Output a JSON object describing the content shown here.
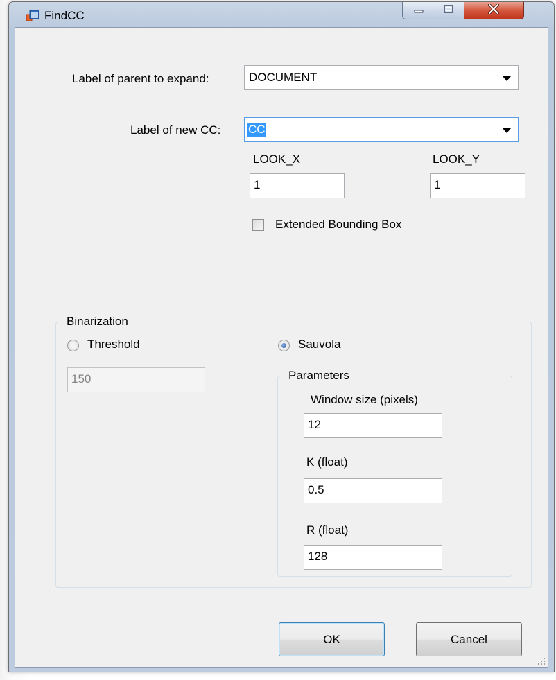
{
  "window": {
    "title": "FindCC"
  },
  "form": {
    "parent_label": "Label of parent to expand:",
    "parent_value": "DOCUMENT",
    "newcc_label": "Label of new CC:",
    "newcc_value": "CC",
    "look_x_label": "LOOK_X",
    "look_x_value": "1",
    "look_y_label": "LOOK_Y",
    "look_y_value": "1",
    "extended_bbox_label": "Extended Bounding Box",
    "extended_bbox_checked": false
  },
  "binarization": {
    "title": "Binarization",
    "threshold_label": "Threshold",
    "threshold_value": "150",
    "sauvola_label": "Sauvola",
    "selected": "Sauvola",
    "parameters": {
      "title": "Parameters",
      "window_size_label": "Window size (pixels)",
      "window_size_value": "12",
      "k_label": "K (float)",
      "k_value": "0.5",
      "r_label": "R (float)",
      "r_value": "128"
    }
  },
  "buttons": {
    "ok": "OK",
    "cancel": "Cancel"
  },
  "icons": {
    "app": "app-window-icon",
    "minimize": "minimize-icon",
    "maximize": "maximize-icon",
    "close": "close-icon",
    "dropdown": "chevron-down-icon",
    "resize": "resize-grip-icon"
  },
  "colors": {
    "selection": "#3399ff",
    "close_button": "#c1361d",
    "titlebar": "#bccbdf"
  }
}
